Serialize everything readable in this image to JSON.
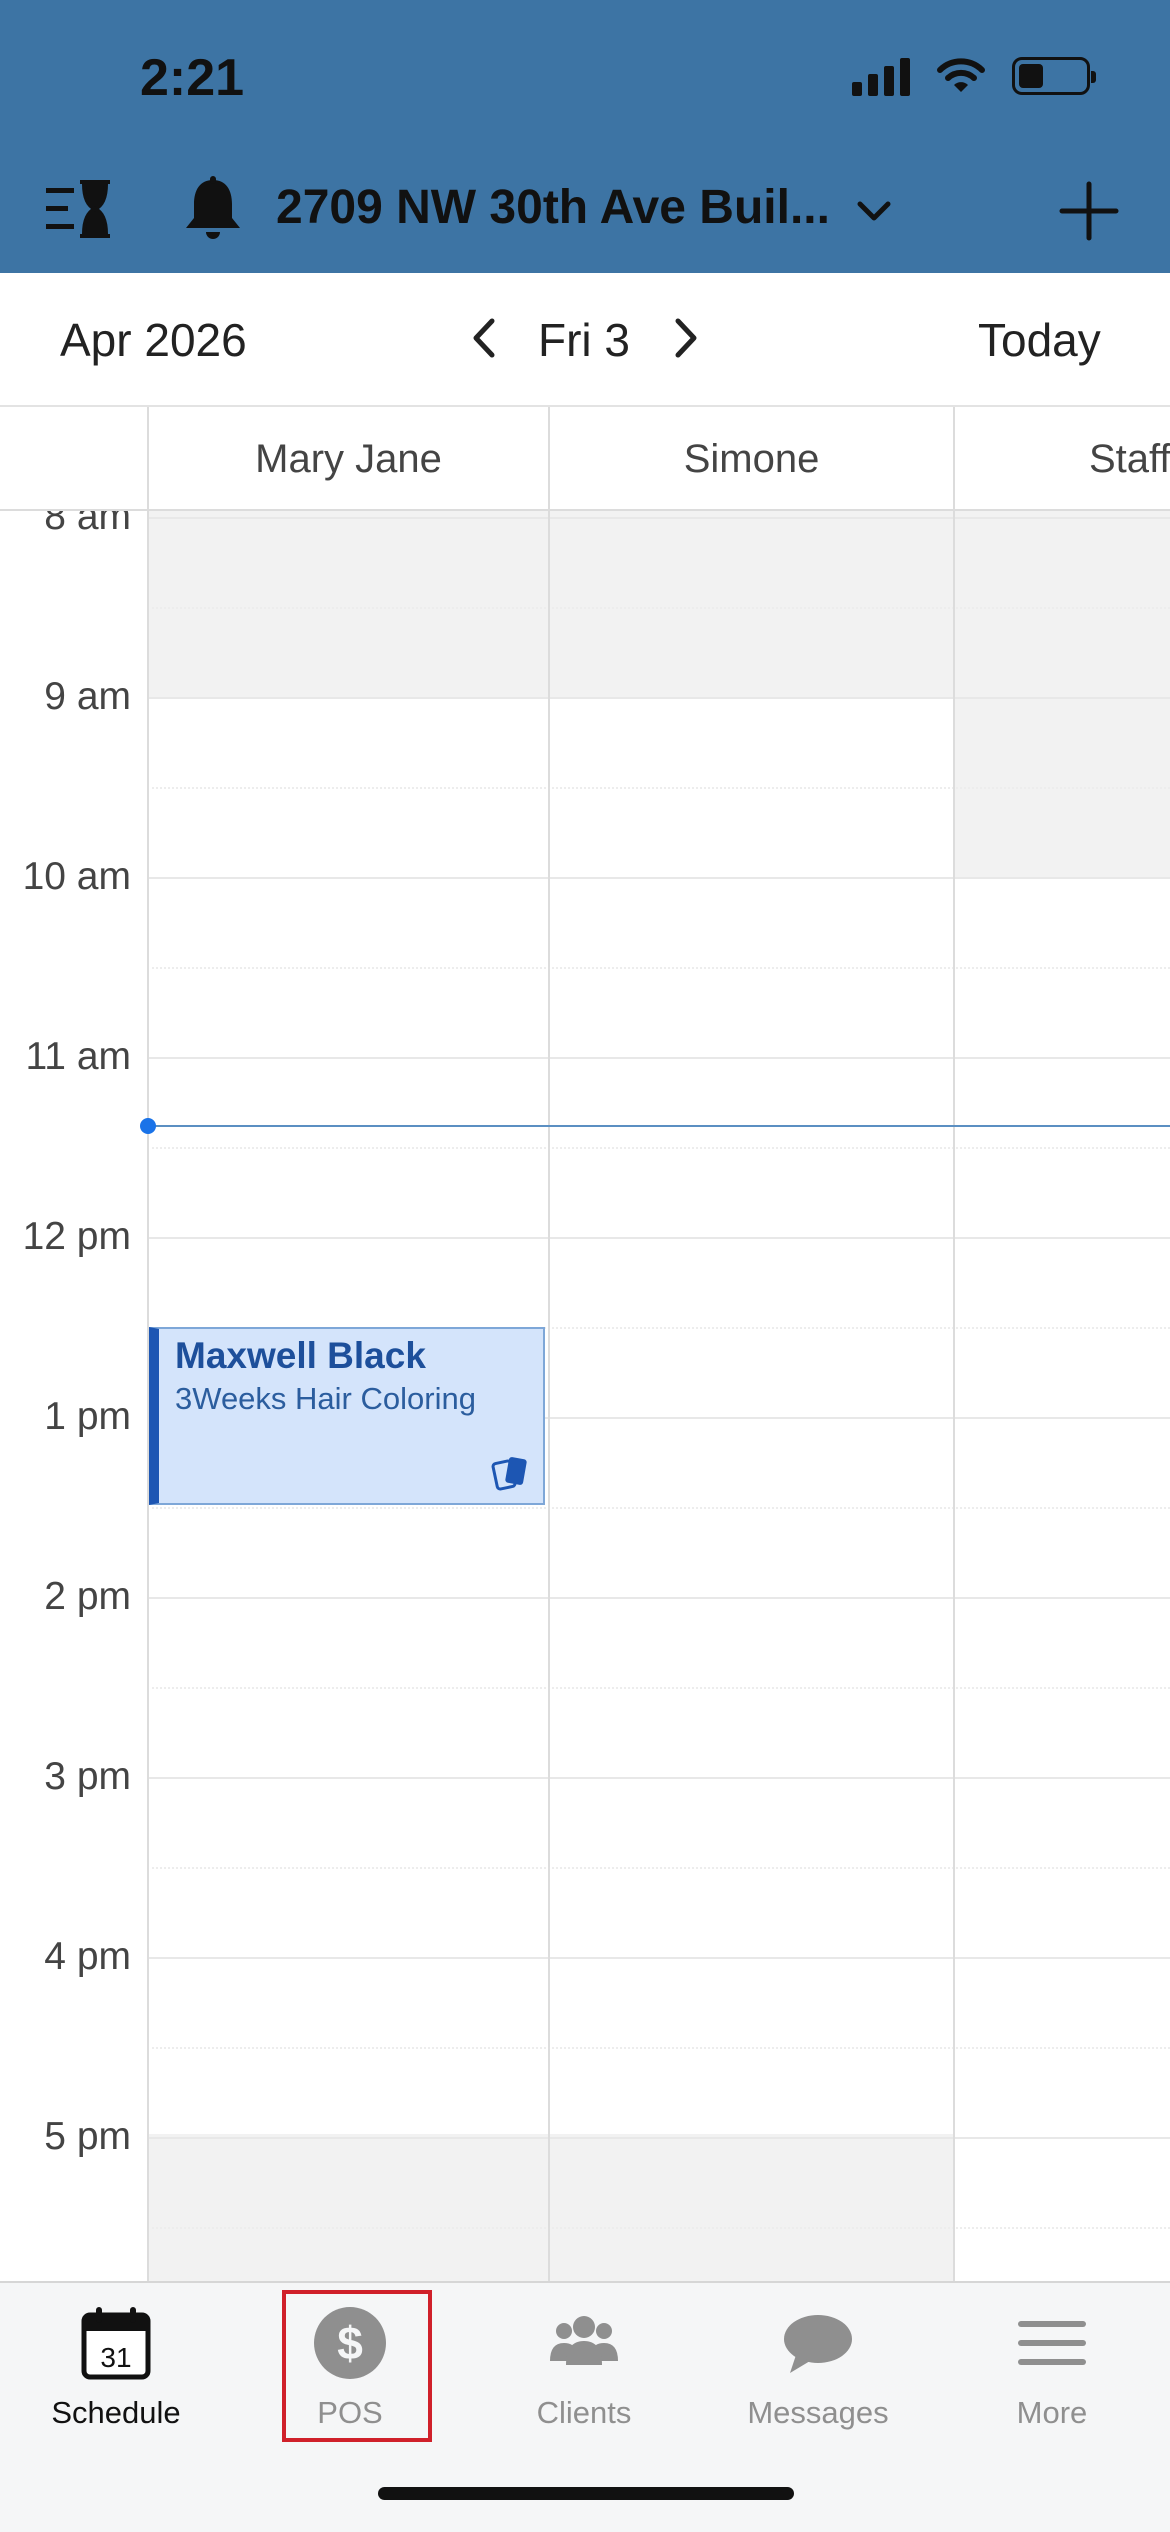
{
  "status_bar": {
    "time": "2:21"
  },
  "toolbar": {
    "location": "2709 NW 30th Ave Buil...",
    "icons": {
      "waitlist": "hourglass-list-icon",
      "notifications": "bell-icon",
      "dropdown": "chevron-down-icon",
      "add": "plus-icon"
    }
  },
  "date_nav": {
    "month": "Apr 2026",
    "day": "Fri 3",
    "today_label": "Today"
  },
  "staff": [
    "Mary Jane",
    "Simone",
    "Staff"
  ],
  "time_labels": [
    "8 am",
    "9 am",
    "10 am",
    "11 am",
    "12 pm",
    "1 pm",
    "2 pm",
    "3 pm",
    "4 pm",
    "5 pm"
  ],
  "appointment": {
    "client": "Maxwell Black",
    "service": "3Weeks Hair Coloring",
    "staff": "Mary Jane",
    "icon": "cards-icon"
  },
  "tabs": [
    {
      "label": "Schedule",
      "icon": "calendar-icon",
      "badge": "31",
      "active": true
    },
    {
      "label": "POS",
      "icon": "dollar-icon",
      "active": false,
      "highlighted": true
    },
    {
      "label": "Clients",
      "icon": "people-icon",
      "active": false
    },
    {
      "label": "Messages",
      "icon": "chat-bubble-icon",
      "active": false
    },
    {
      "label": "More",
      "icon": "menu-icon",
      "active": false
    }
  ],
  "colors": {
    "header": "#3d74a4",
    "appointment_fill": "#d4e4fb",
    "appointment_accent": "#1d56b3",
    "now_indicator": "#1a73e8",
    "highlight": "#d0202a"
  }
}
